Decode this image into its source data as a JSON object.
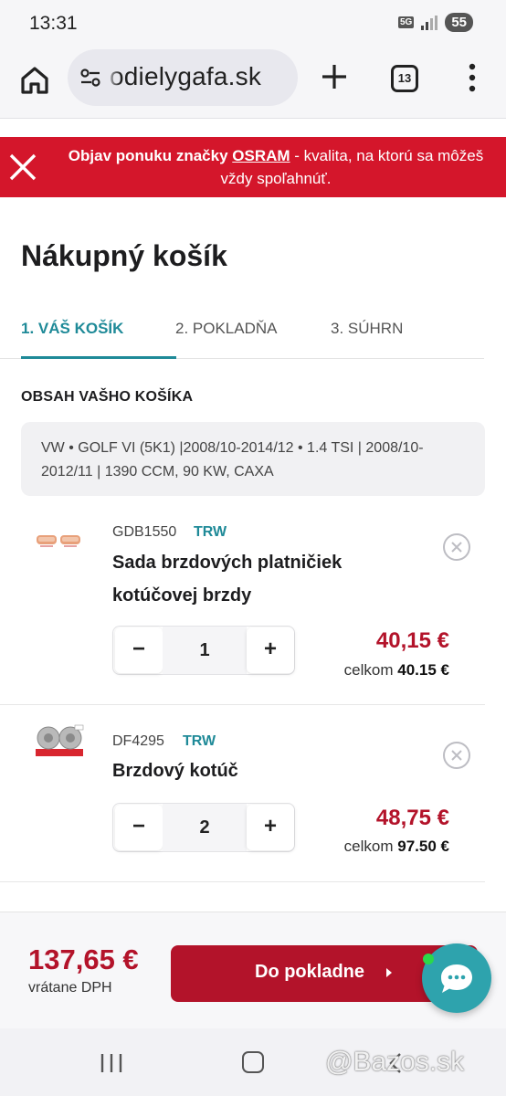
{
  "status_bar": {
    "time": "13:31",
    "network": "5G",
    "battery": "55"
  },
  "browser": {
    "url": "odielygafa.sk",
    "tab_count": "13"
  },
  "promo_banner": {
    "text_before": "Objav ponuku značky ",
    "brand": "OSRAM",
    "text_after": " - kvalita, na ktorú sa môžeš vždy spoľahnúť."
  },
  "page": {
    "title": "Nákupný košík"
  },
  "steps": [
    {
      "label": "1. VÁŠ KOŠÍK",
      "active": true
    },
    {
      "label": "2. POKLADŇA",
      "active": false
    },
    {
      "label": "3. SÚHRN",
      "active": false
    }
  ],
  "cart": {
    "section_title": "OBSAH VAŠHO KOŠÍKA",
    "vehicle": "VW   •   GOLF VI (5K1) |2008/10-2014/12   •   1.4 TSI | 2008/10-2012/11 | 1390 CCM, 90 KW, CAXA",
    "items": [
      {
        "code": "GDB1550",
        "brand": "TRW",
        "name": "Sada brzdových platničiek kotúčovej brzdy",
        "qty": "1",
        "price": "40,15 €",
        "total_label": "celkom",
        "total_value": "40.15 €",
        "image": "brake-pads"
      },
      {
        "code": "DF4295",
        "brand": "TRW",
        "name": "Brzdový kotúč",
        "qty": "2",
        "price": "48,75 €",
        "total_label": "celkom",
        "total_value": "97.50 €",
        "image": "brake-disc"
      }
    ],
    "minus": "−",
    "plus": "+"
  },
  "checkout": {
    "total": "137,65 €",
    "vat_note": "vrátane DPH",
    "button_label": "Do pokladne"
  },
  "watermark": "@Bazos.sk",
  "colors": {
    "accent": "#1f8a98",
    "brand_red": "#b3132a",
    "banner_red": "#d4162b",
    "chat": "#2ea3ad"
  }
}
